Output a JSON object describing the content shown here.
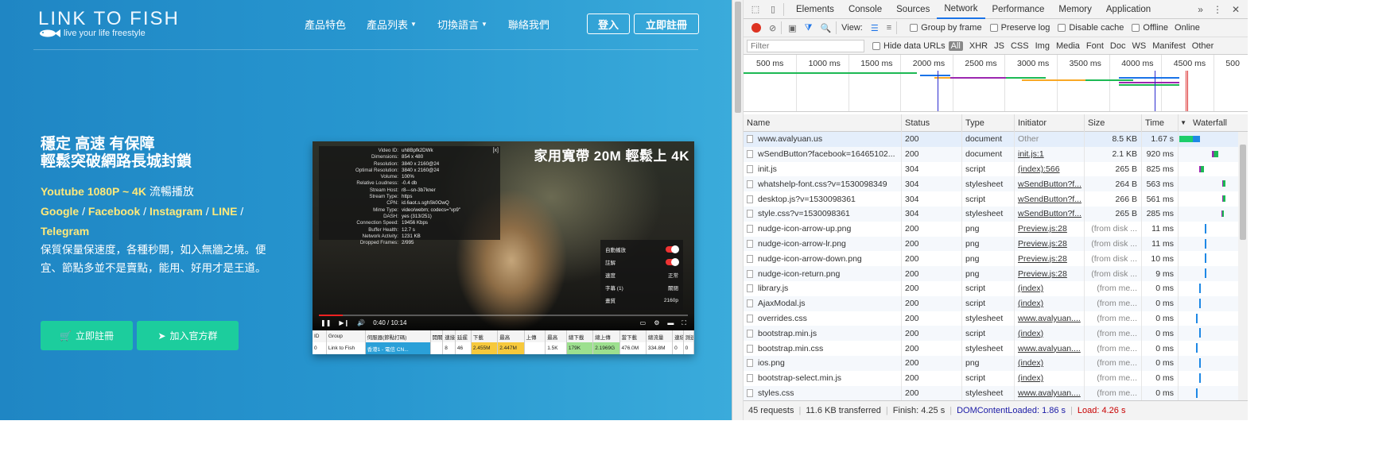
{
  "site": {
    "logo_main": "LINK TO FISH",
    "logo_sub": "live your life freestyle",
    "nav": [
      {
        "label": "產品特色",
        "dropdown": false
      },
      {
        "label": "產品列表",
        "dropdown": true
      },
      {
        "label": "切換語言",
        "dropdown": true
      },
      {
        "label": "聯絡我們",
        "dropdown": false
      }
    ],
    "login": "登入",
    "register": "立即註冊",
    "hero_line1": "穩定 高速 有保障",
    "hero_line2": "輕鬆突破網路長城封鎖",
    "sub_youtube": "Youtube 1080P ~ 4K",
    "sub_youtube_tail": " 流暢播放",
    "sub_sites": [
      "Google",
      "Facebook",
      "Instagram",
      "LINE",
      "Telegram"
    ],
    "desc": "保質保量保速度，各種秒開，如入無牆之境。便宜、節點多並不是賣點，能用、好用才是王道。",
    "cta1": "立即註冊",
    "cta2": "加入官方群",
    "colors": {
      "accent_yellow": "#ffe97a",
      "cta_green": "#1ccd9d",
      "bg_blue": "#2796cf"
    }
  },
  "video": {
    "banner": "家用寬帶 20M 輕鬆上 4K",
    "stats": [
      [
        "Video ID:",
        "uh8Bpfk2DWk"
      ],
      [
        "Dimensions:",
        "854 x 480"
      ],
      [
        "Resolution:",
        "3840 x 2160@24"
      ],
      [
        "Optimal Resolution:",
        "3840 x 2160@24"
      ],
      [
        "Volume:",
        "100%"
      ],
      [
        "Relative Loudness:",
        "-0.4 db"
      ],
      [
        "Stream Host:",
        "r8---sn-3b7kner"
      ],
      [
        "Stream Type:",
        "https"
      ],
      [
        "CPN:",
        "id.6aot.s.sghSk0OwQ"
      ],
      [
        "Mime Type:",
        "video/webm; codecs=\"vp9\""
      ],
      [
        "DASH:",
        "yes (313/251)"
      ],
      [
        "Connection Speed:",
        "19456 Kbps"
      ],
      [
        "Buffer Health:",
        "12.7 s"
      ],
      [
        "Network Activity:",
        "1231 KB"
      ],
      [
        "Dropped Frames:",
        "2/995"
      ]
    ],
    "menu": [
      {
        "label": "自動播放",
        "value": "toggle"
      },
      {
        "label": "註解",
        "value": "toggle"
      },
      {
        "label": "速度",
        "value": "正常"
      },
      {
        "label": "字幕 (1)",
        "value": "關閉"
      },
      {
        "label": "畫質",
        "value": "2160p"
      }
    ],
    "time": "0:40 / 10:14",
    "progress_fraction": 0.065,
    "table_head": [
      "ID",
      "Group",
      "伺服器(節點打碼)",
      "開關",
      "連接",
      "延遲",
      "下載",
      "最高",
      "上傳",
      "最高",
      "總下載",
      "總上傳",
      "當下載",
      "總流量",
      "連結",
      "測速"
    ],
    "table_row": [
      "0",
      "Link to Fish",
      "香港1 - 電信 CN...",
      "",
      "8",
      "46",
      "2.455M",
      "2.447M",
      "",
      "1.5K",
      "179K",
      "2.1969G",
      "476.0M",
      "334.8M",
      "0",
      "0"
    ]
  },
  "devtools": {
    "tabs": [
      "Elements",
      "Console",
      "Sources",
      "Network",
      "Performance",
      "Memory",
      "Application"
    ],
    "active_tab": "Network",
    "view_label": "View:",
    "checkboxes": [
      "Group by frame",
      "Preserve log",
      "Disable cache",
      "Offline"
    ],
    "online": "Online",
    "filter_placeholder": "Filter",
    "hide_data_urls": "Hide data URLs",
    "all": "All",
    "types": [
      "XHR",
      "JS",
      "CSS",
      "Img",
      "Media",
      "Font",
      "Doc",
      "WS",
      "Manifest",
      "Other"
    ],
    "ticks": [
      "500 ms",
      "1000 ms",
      "1500 ms",
      "2000 ms",
      "2500 ms",
      "3000 ms",
      "3500 ms",
      "4000 ms",
      "4500 ms",
      "500"
    ],
    "columns": [
      "Name",
      "Status",
      "Type",
      "Initiator",
      "Size",
      "Time",
      "Waterfall"
    ],
    "rows": [
      {
        "name": "www.avalyuan.us",
        "status": "200",
        "type": "document",
        "initiator": "Other",
        "init_link": false,
        "size": "8.5 KB",
        "size_grey": false,
        "time": "1.67 s"
      },
      {
        "name": "wSendButton?facebook=16465102...",
        "status": "200",
        "type": "document",
        "initiator": "init.js:1",
        "init_link": true,
        "size": "2.1 KB",
        "size_grey": false,
        "time": "920 ms"
      },
      {
        "name": "init.js",
        "status": "304",
        "type": "script",
        "initiator": "(index):566",
        "init_link": true,
        "size": "265 B",
        "size_grey": false,
        "time": "825 ms"
      },
      {
        "name": "whatshelp-font.css?v=1530098349",
        "status": "304",
        "type": "stylesheet",
        "initiator": "wSendButton?f...",
        "init_link": true,
        "size": "264 B",
        "size_grey": false,
        "time": "563 ms"
      },
      {
        "name": "desktop.js?v=1530098361",
        "status": "304",
        "type": "script",
        "initiator": "wSendButton?f...",
        "init_link": true,
        "size": "266 B",
        "size_grey": false,
        "time": "561 ms"
      },
      {
        "name": "style.css?v=1530098361",
        "status": "304",
        "type": "stylesheet",
        "initiator": "wSendButton?f...",
        "init_link": true,
        "size": "265 B",
        "size_grey": false,
        "time": "285 ms"
      },
      {
        "name": "nudge-icon-arrow-up.png",
        "status": "200",
        "type": "png",
        "initiator": "Preview.js:28",
        "init_link": true,
        "size": "(from disk ...",
        "size_grey": true,
        "time": "11 ms"
      },
      {
        "name": "nudge-icon-arrow-lr.png",
        "status": "200",
        "type": "png",
        "initiator": "Preview.js:28",
        "init_link": true,
        "size": "(from disk ...",
        "size_grey": true,
        "time": "11 ms"
      },
      {
        "name": "nudge-icon-arrow-down.png",
        "status": "200",
        "type": "png",
        "initiator": "Preview.js:28",
        "init_link": true,
        "size": "(from disk ...",
        "size_grey": true,
        "time": "10 ms"
      },
      {
        "name": "nudge-icon-return.png",
        "status": "200",
        "type": "png",
        "initiator": "Preview.js:28",
        "init_link": true,
        "size": "(from disk ...",
        "size_grey": true,
        "time": "9 ms"
      },
      {
        "name": "library.js",
        "status": "200",
        "type": "script",
        "initiator": "(index)",
        "init_link": true,
        "size": "(from me...",
        "size_grey": true,
        "time": "0 ms"
      },
      {
        "name": "AjaxModal.js",
        "status": "200",
        "type": "script",
        "initiator": "(index)",
        "init_link": true,
        "size": "(from me...",
        "size_grey": true,
        "time": "0 ms"
      },
      {
        "name": "overrides.css",
        "status": "200",
        "type": "stylesheet",
        "initiator": "www.avalyuan....",
        "init_link": true,
        "size": "(from me...",
        "size_grey": true,
        "time": "0 ms"
      },
      {
        "name": "bootstrap.min.js",
        "status": "200",
        "type": "script",
        "initiator": "(index)",
        "init_link": true,
        "size": "(from me...",
        "size_grey": true,
        "time": "0 ms"
      },
      {
        "name": "bootstrap.min.css",
        "status": "200",
        "type": "stylesheet",
        "initiator": "www.avalyuan....",
        "init_link": true,
        "size": "(from me...",
        "size_grey": true,
        "time": "0 ms"
      },
      {
        "name": "ios.png",
        "status": "200",
        "type": "png",
        "initiator": "(index)",
        "init_link": true,
        "size": "(from me...",
        "size_grey": true,
        "time": "0 ms"
      },
      {
        "name": "bootstrap-select.min.js",
        "status": "200",
        "type": "script",
        "initiator": "(index)",
        "init_link": true,
        "size": "(from me...",
        "size_grey": true,
        "time": "0 ms"
      },
      {
        "name": "styles.css",
        "status": "200",
        "type": "stylesheet",
        "initiator": "www.avalyuan....",
        "init_link": true,
        "size": "(from me...",
        "size_grey": true,
        "time": "0 ms"
      }
    ],
    "status_requests": "45 requests",
    "status_transferred": "11.6 KB transferred",
    "status_finish": "Finish: 4.25 s",
    "status_dcl": "DOMContentLoaded: 1.86 s",
    "status_load": "Load: 4.26 s"
  }
}
